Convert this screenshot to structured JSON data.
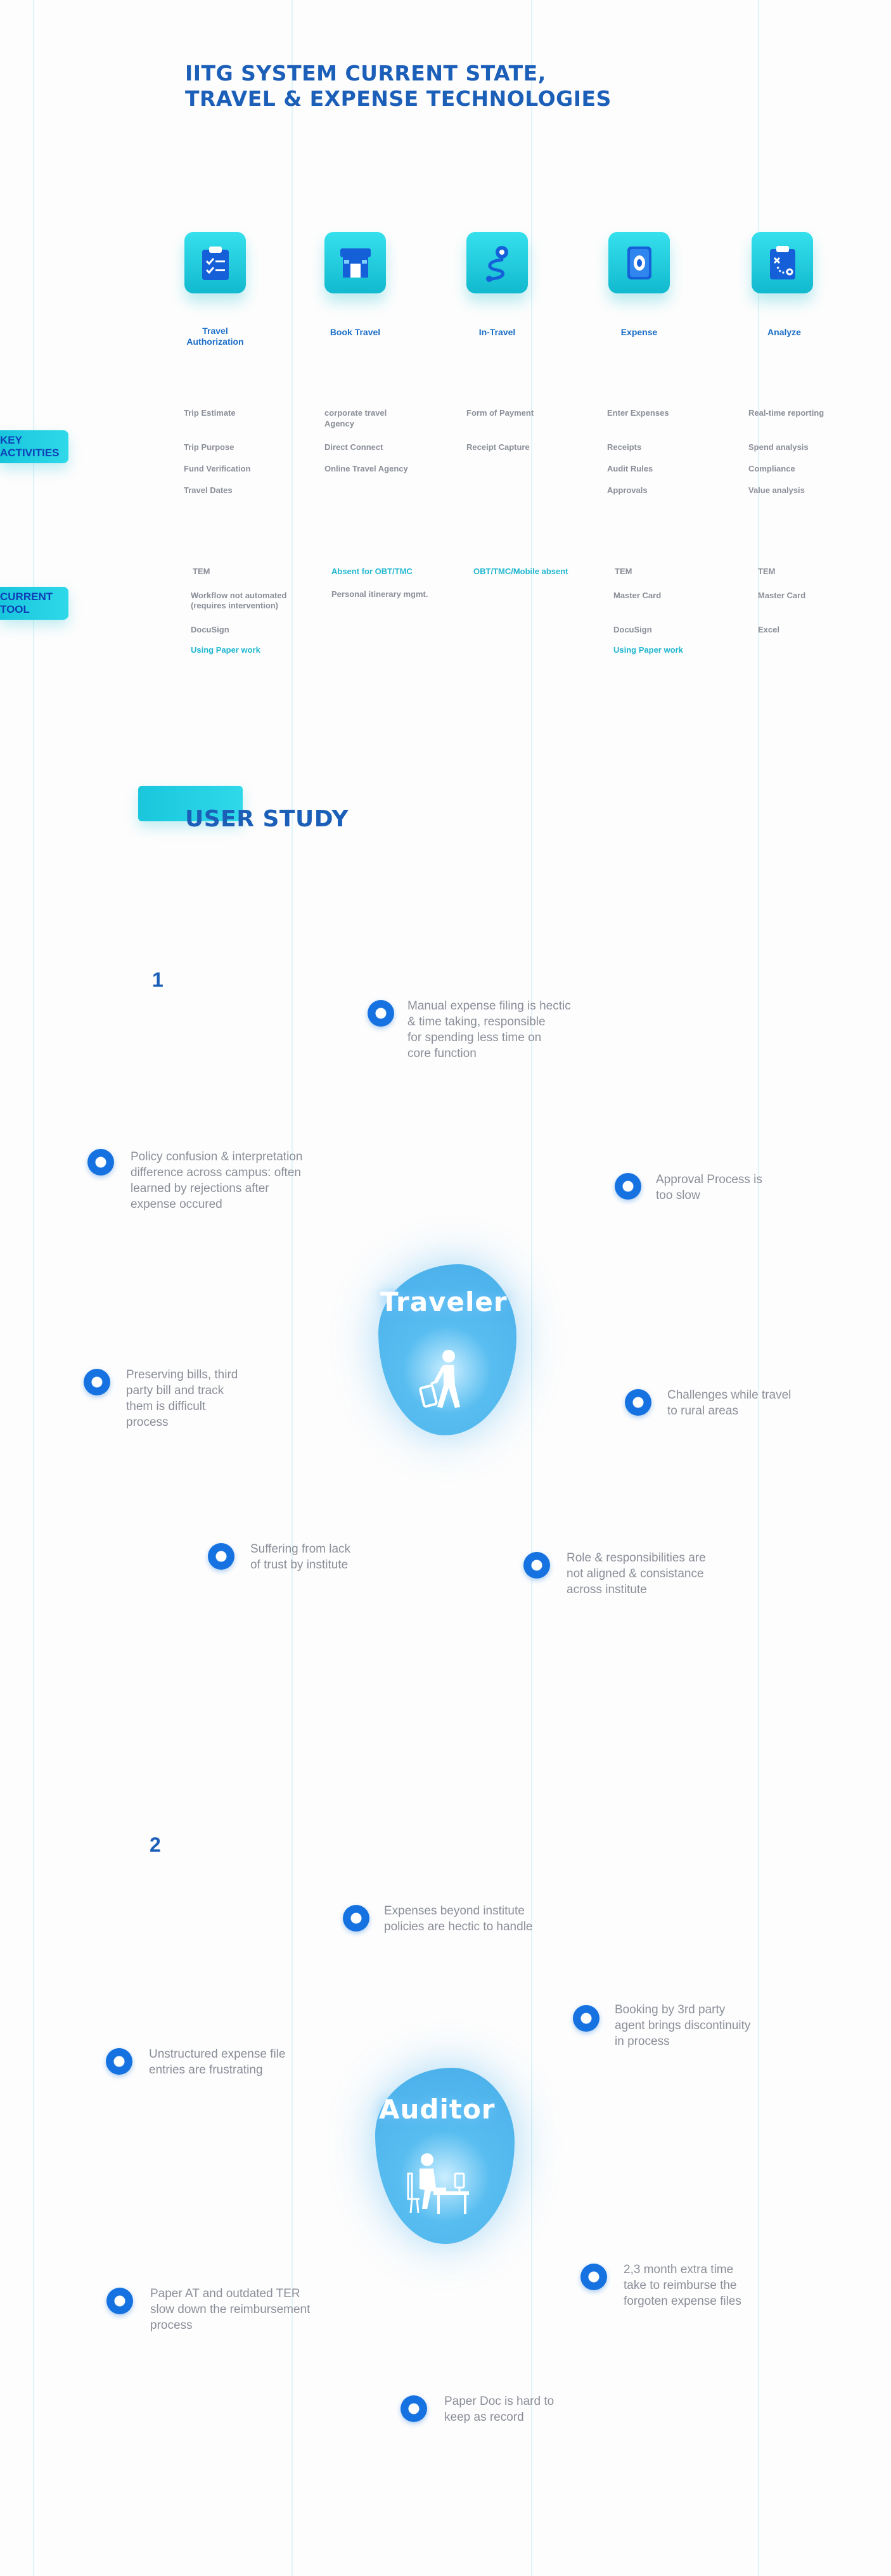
{
  "page": {
    "title": "IITG SYSTEM CURRENT STATE,\nTRAVEL & EXPENSE TECHNOLOGIES"
  },
  "stages": [
    {
      "label": "Travel\nAuthorization",
      "icon": "clipboard-checklist-icon"
    },
    {
      "label": "Book Travel",
      "icon": "travel-agency-icon"
    },
    {
      "label": "In-Travel",
      "icon": "map-route-icon"
    },
    {
      "label": "Expense",
      "icon": "money-bill-icon"
    },
    {
      "label": "Analyze",
      "icon": "clipboard-analysis-icon"
    }
  ],
  "key_activities": {
    "label": "KEY ACTIVITIES",
    "columns": [
      [
        "Trip Estimate",
        "Trip Purpose",
        "Fund Verification",
        "Travel Dates"
      ],
      [
        "corporate travel\nAgency",
        "Direct Connect",
        "Online Travel Agency"
      ],
      [
        "Form of Payment",
        "Receipt Capture"
      ],
      [
        "Enter Expenses",
        "Receipts",
        "Audit Rules",
        "Approvals"
      ],
      [
        "Real-time reporting",
        "Spend analysis",
        "Compliance",
        "Value analysis"
      ]
    ]
  },
  "current_tool": {
    "label": "CURRENT TOOL",
    "col1": {
      "tem": "TEM",
      "workflow": "Workflow not automated\n(requires intervention)",
      "docusign": "DocuSign",
      "paper": "Using Paper work"
    },
    "col2": {
      "absent": "Absent for OBT/TMC",
      "itinerary": "Personal itinerary mgmt."
    },
    "col3": {
      "absent": "OBT/TMC/Mobile absent"
    },
    "col4": {
      "tem": "TEM",
      "mastercard": "Master Card",
      "docusign": "DocuSign",
      "paper": "Using Paper work"
    },
    "col5": {
      "tem": "TEM",
      "mastercard": "Master Card",
      "excel": "Excel"
    }
  },
  "user_study": {
    "title": "USER STUDY",
    "traveler": {
      "number": "1",
      "persona": "Traveler",
      "icon": "person-with-luggage-icon",
      "points": [
        "Manual expense filing is hectic\n& time taking, responsible\nfor spending less time on\ncore function",
        "Policy confusion & interpretation\ndifference across campus: often\nlearned by rejections after\nexpense occured",
        "Approval Process is\ntoo slow",
        "Preserving bills, third\nparty bill and track\nthem is difficult\nprocess",
        "Challenges while travel\nto rural areas",
        "Suffering from lack\nof trust by institute",
        "Role & responsibilities are\nnot aligned & consistance\nacross institute"
      ]
    },
    "auditor": {
      "number": "2",
      "persona": "Auditor",
      "icon": "person-at-desk-icon",
      "points": [
        "Expenses beyond institute\npolicies are hectic to handle",
        "Booking by 3rd party\nagent brings discontinuity\nin process",
        "Unstructured expense file\nentries are frustrating",
        "2,3 month extra time\ntake to reimburse the\nforgoten expense files",
        "Paper AT and outdated TER\nslow down the reimbursement\nprocess",
        "Paper Doc is hard to\nkeep as record"
      ]
    }
  },
  "colors": {
    "accent_blue": "#1c5fb8",
    "teal": "#19c6dc",
    "point_blue": "#1572e0",
    "text_gray": "#8a8e98"
  }
}
